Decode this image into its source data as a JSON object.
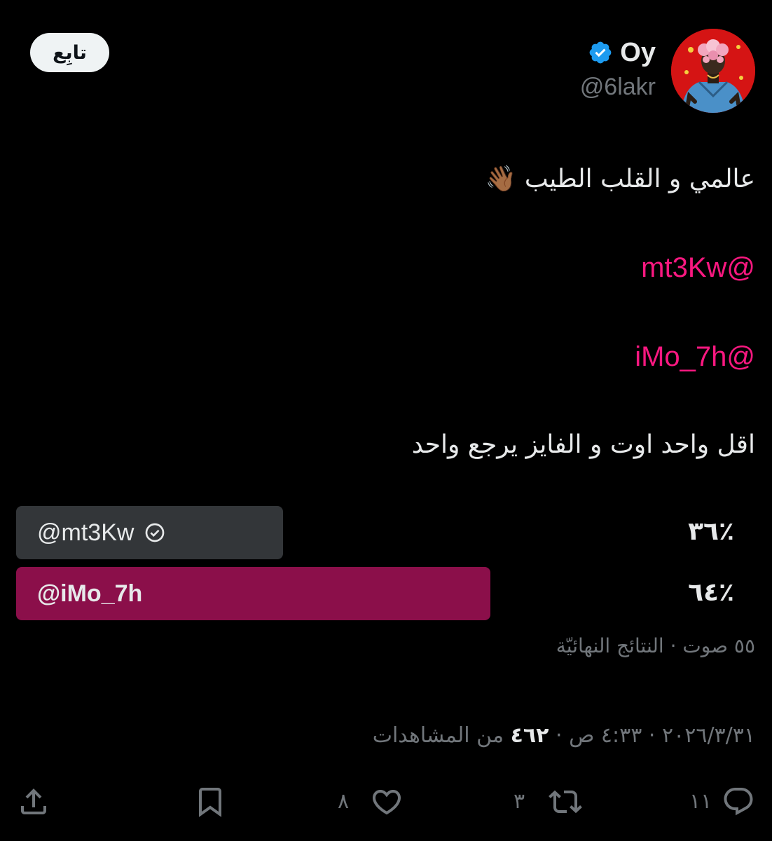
{
  "header": {
    "follow_label": "تابِع",
    "display_name": "Oy",
    "handle": "@6lakr",
    "avatar_icon": "avatar-illustration",
    "verified_icon": "verified-badge-icon",
    "verified_color": "#1d9bf0"
  },
  "tweet": {
    "line1": "عالمي و القلب الطيب 👋🏾",
    "mention1": "@mt3Kw",
    "mention2": "@iMo_7h",
    "line2": "اقل واحد اوت و الفايز يرجع واحد"
  },
  "poll": {
    "options": [
      {
        "label": "@mt3Kw",
        "percent_text": "٣٦٪",
        "percent": 36,
        "winner": false
      },
      {
        "label": "@iMo_7h",
        "percent_text": "٦٤٪",
        "percent": 64,
        "winner": true
      }
    ],
    "meta": "٥٥ صوت · النتائج النهائيّة",
    "bar_color": "#333639",
    "winner_color": "#8b0f4a",
    "mention_color": "#f91880"
  },
  "meta": {
    "date": "٢٠٢٦/٣/٣١",
    "time": "٤:٣٣ ص",
    "views_count": "٤٦٢",
    "views_label": "من المشاهدات"
  },
  "actions": {
    "reply_count": "١١",
    "retweet_count": "٣",
    "like_count": "٨"
  }
}
